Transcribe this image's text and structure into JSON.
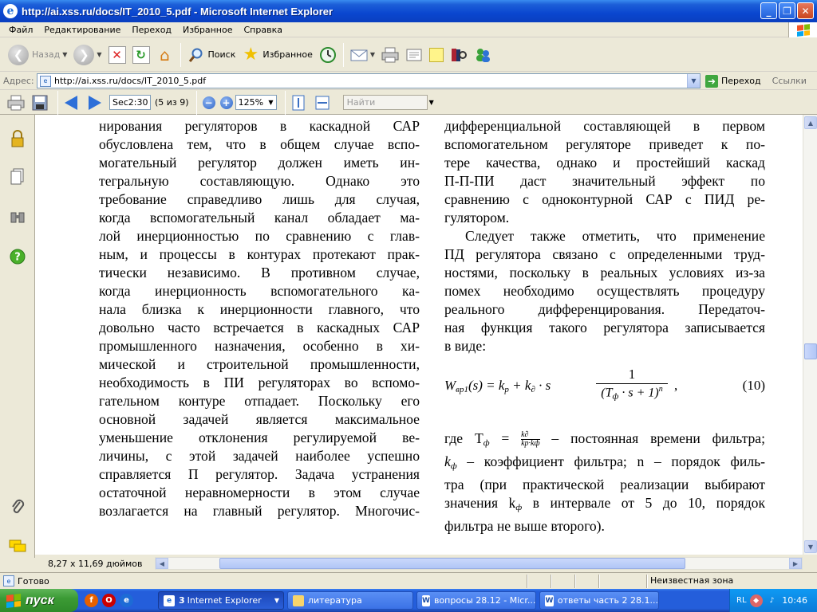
{
  "window": {
    "title": "http://ai.xss.ru/docs/IT_2010_5.pdf - Microsoft Internet Explorer",
    "buttons": [
      "_",
      "❐",
      "✕"
    ]
  },
  "menu": [
    "Файл",
    "Редактирование",
    "Переход",
    "Избранное",
    "Справка"
  ],
  "toolbar": {
    "back_label": "Назад",
    "search_label": "Поиск",
    "favorites_label": "Избранное"
  },
  "address": {
    "label": "Адрес:",
    "url": "http://ai.xss.ru/docs/IT_2010_5.pdf",
    "go_label": "Переход",
    "links_label": "Ссылки"
  },
  "pdf_toolbar": {
    "page_field": "Sec2:30",
    "page_of": "(5 из 9)",
    "zoom": "125%",
    "find_placeholder": "Найти"
  },
  "document": {
    "left_column": [
      "нирования регуляторов в каскадной САР",
      "обусловлена тем, что в общем случае вспо-",
      "могательный регулятор должен иметь ин-",
      "тегральную составляющую. Однако это",
      "требование справедливо лишь для случая,",
      "когда вспомогательный канал обладает ма-",
      "лой инерционностью по сравнению с глав-",
      "ным, и процессы в контурах протекают прак-",
      "тически независимо. В противном случае,",
      "когда инерционность вспомогательного ка-",
      "нала близка к инерционности главного, что",
      "довольно часто встречается в каскадных САР",
      "промышленного назначения, особенно в хи-",
      "мической и строительной промышленности,",
      "необходимость в ПИ регуляторах во вспомо-",
      "гательном контуре отпадает. Поскольку его",
      "основной задачей является максимальное",
      "уменьшение отклонения регулируемой ве-",
      "личины, с этой задачей наиболее успешно",
      "справляется П регулятор. Задача устранения",
      "остаточной неравномерности в этом случае",
      "возлагается на главный регулятор. Многочис-"
    ],
    "right_column_top": [
      "дифференциальной составляющей в первом",
      "вспомогательном регуляторе приведет к по-",
      "тере качества, однако и простейший каскад",
      "П-П-ПИ даст значительный эффект по",
      "сравнению с одноконтурной САР с ПИД ре-",
      "гулятором."
    ],
    "right_column_para2": [
      "Следует также отметить, что применение",
      "ПД регулятора связано с определенными труд-",
      "ностями, поскольку в реальных условиях из-за",
      "помех необходимо осуществлять процедуру",
      "реального дифференцирования. Передаточ-",
      "ная функция такого регулятора записывается",
      "в виде:"
    ],
    "formula": {
      "lhs": "W",
      "lhs_sub": "вр1",
      "arg": "(s) = k",
      "kp_sub": "p",
      "plus": " + k",
      "kd_sub": "∂",
      "dot_s": " · s",
      "num": "1",
      "den": "(T",
      "den_sub": "ф",
      "den_rest": " · s + 1)",
      "den_exp": "n",
      "comma": ",",
      "eq_number": "(10)"
    },
    "right_column_bottom": {
      "line1_prefix": "где T",
      "line1_sub": "ф",
      "line1_eq": " = ",
      "mini_num": "k∂",
      "mini_den": "kp·kф",
      "line1_rest": " – постоянная времени фильтра;",
      "line2_k": "k",
      "line2_sub": "ф",
      "line2_rest": " – коэффициент фильтра; n – порядок филь-",
      "line3": "тра (при практической реализации выбирают",
      "line4_prefix": "значения k",
      "line4_sub": "ф",
      "line4_rest": "  в интервале от 5 до 10, порядок",
      "line5": "фильтра не выше второго)."
    }
  },
  "page_size": "8,27 x 11,69 дюймов",
  "status": {
    "text": "Готово",
    "zone": "Неизвестная зона"
  },
  "taskbar": {
    "start_label": "пуск",
    "tasks": [
      {
        "count": "3",
        "label": "Internet Explorer"
      },
      {
        "label": "литература"
      },
      {
        "label": "вопросы 28.12 - Micr..."
      },
      {
        "label": "ответы часть 2 28.1..."
      }
    ],
    "lang": "RL",
    "clock": "10:46"
  }
}
